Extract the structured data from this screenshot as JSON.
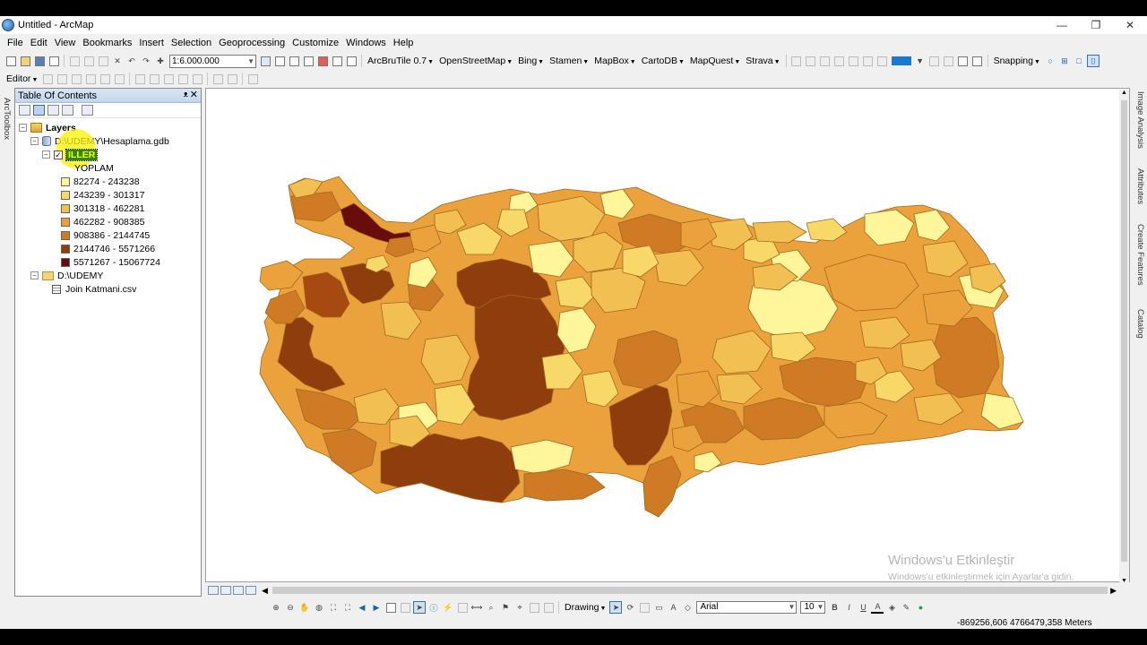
{
  "window": {
    "title": "Untitled - ArcMap",
    "controls": [
      "—",
      "❐",
      "✕"
    ]
  },
  "menu": [
    "File",
    "Edit",
    "View",
    "Bookmarks",
    "Insert",
    "Selection",
    "Geoprocessing",
    "Customize",
    "Windows",
    "Help"
  ],
  "toolbar": {
    "scale": "1:6.000.000",
    "basemaps": [
      "ArcBruTile 0.7",
      "OpenStreetMap",
      "Bing",
      "Stamen",
      "MapBox",
      "CartoDB",
      "MapQuest",
      "Strava"
    ],
    "snapping": "Snapping"
  },
  "editor": {
    "label": "Editor"
  },
  "toc": {
    "title": "Table Of Contents",
    "layers_label": "Layers",
    "gdb": "D:\\UDEMY\\Hesaplama.gdb",
    "layer_name": "ILLER",
    "field": "YOPLAM",
    "classes": [
      {
        "label": "82274 - 243238",
        "color": "#fff59b"
      },
      {
        "label": "243239 - 301317",
        "color": "#f9d86a"
      },
      {
        "label": "301318 - 462281",
        "color": "#f2bf53"
      },
      {
        "label": "462282 - 908385",
        "color": "#eba23c"
      },
      {
        "label": "908386 - 2144745",
        "color": "#cf7a25"
      },
      {
        "label": "2144746 - 5571266",
        "color": "#8f3d0c"
      },
      {
        "label": "5571267 - 15067724",
        "color": "#6a0c0c"
      }
    ],
    "folder": "D:\\UDEMY",
    "table": "Join Katmani.csv"
  },
  "side_left": [
    "ArcToolbox"
  ],
  "side_right": [
    "Image Analysis",
    "Attributes",
    "Create Features",
    "Catalog"
  ],
  "drawing": {
    "label": "Drawing",
    "font": "Arial",
    "size": "10"
  },
  "status": {
    "coords": "-869256,606  4766479,358 Meters"
  },
  "watermark": {
    "line1": "Windows'u Etkinleştir",
    "line2": "Windows'u etkinleştirmek için Ayarlar'a gidin."
  }
}
